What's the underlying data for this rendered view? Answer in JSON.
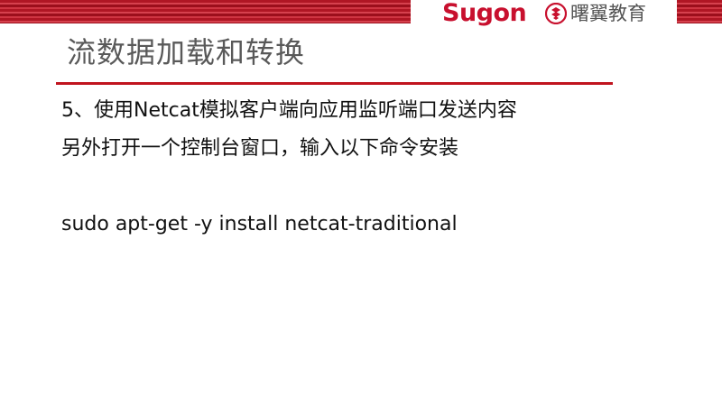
{
  "header": {
    "brand": "Sugon",
    "partner": "曙翼教育",
    "colors": {
      "accent": "#c0141f",
      "band": "#b01624"
    }
  },
  "slide": {
    "title": "流数据加载和转换",
    "lines": [
      "5、使用Netcat模拟客户端向应用监听端口发送内容",
      "另外打开一个控制台窗口，输入以下命令安装",
      "sudo apt-get -y install netcat-traditional"
    ]
  }
}
